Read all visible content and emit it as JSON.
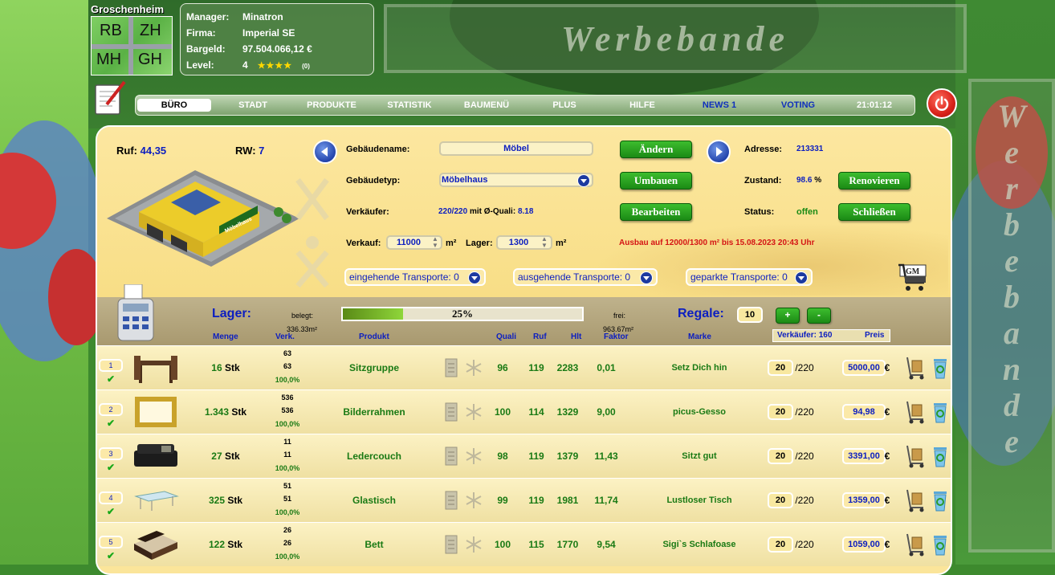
{
  "ad": {
    "top_text": "Werbebande",
    "right_letters": [
      "W",
      "e",
      "r",
      "b",
      "e",
      "b",
      "a",
      "n",
      "d",
      "e"
    ]
  },
  "city": {
    "name": "Groschenheim",
    "minimap_labels": [
      "RB",
      "ZH",
      "MH",
      "GH"
    ]
  },
  "manager_info": {
    "manager_label": "Manager:",
    "manager_value": "Minatron",
    "firma_label": "Firma:",
    "firma_value": "Imperial SE",
    "bargeld_label": "Bargeld:",
    "bargeld_value": "97.504.066,12 €",
    "level_label": "Level:",
    "level_value": "4",
    "level_stars": "★★★★",
    "level_count": "(0)"
  },
  "nav": {
    "items": [
      "BÜRO",
      "STADT",
      "PRODUKTE",
      "STATISTIK",
      "BAUMENÜ",
      "PLUS",
      "HILFE",
      "NEWS 1",
      "VOTING"
    ],
    "active": "BÜRO",
    "clock": "21:01:12"
  },
  "building": {
    "ruf_label": "Ruf:",
    "ruf_value": "44,35",
    "rw_label": "RW:",
    "rw_value": "7",
    "name_label": "Gebäudename:",
    "name_value": "Möbel",
    "type_label": "Gebäudetyp:",
    "type_value": "Möbelhaus",
    "verkaeufer_label": "Verkäufer:",
    "verkaeufer_value": "220/220",
    "quali_label": "mit Ø-Quali:",
    "quali_value": "8.18",
    "verkauf_label": "Verkauf:",
    "verkauf_value": "11000",
    "lager_label": "Lager:",
    "lager_value": "1300",
    "unit": "m²",
    "ausbau_notice": "Ausbau auf 12000/1300 m² bis 15.08.2023 20:43 Uhr",
    "adresse_label": "Adresse:",
    "adresse_value": "213331",
    "zustand_label": "Zustand:",
    "zustand_value": "98.6",
    "zustand_unit": "%",
    "status_label": "Status:",
    "status_value": "offen",
    "sign_text": "Möbelhaus"
  },
  "buttons": {
    "aendern": "Ändern",
    "umbauen": "Umbauen",
    "bearbeiten": "Bearbeiten",
    "renovieren": "Renovieren",
    "schliessen": "Schließen"
  },
  "transports": {
    "incoming": "eingehende Transporte: 0",
    "outgoing": "ausgehende Transporte: 0",
    "parked": "geparkte Transporte: 0"
  },
  "cart_label": "GM",
  "lager": {
    "title": "Lager:",
    "belegt_label": "belegt:",
    "belegt_value": "336.33m²",
    "progress": 0.25,
    "progress_text": "25%",
    "frei_label": "frei:",
    "frei_value": "963.67m²",
    "regale_label": "Regale:",
    "regale_value": "10",
    "plus": "+",
    "minus": "-"
  },
  "columns": {
    "menge": "Menge",
    "verk": "Verk.",
    "produkt": "Produkt",
    "quali": "Quali",
    "ruf": "Ruf",
    "hlt": "Hlt",
    "faktor": "Faktor",
    "marke": "Marke",
    "verkaeufer": "Verkäufer: 160",
    "preis": "Preis"
  },
  "rows": [
    {
      "num": "1",
      "menge": "16",
      "unit": "Stk",
      "verk1": "63",
      "verk2": "63",
      "verk_pct": "100,0%",
      "produkt": "Sitzgruppe",
      "quali": "96",
      "ruf": "119",
      "hlt": "2283",
      "faktor": "0,01",
      "marke": "Setz Dich hin",
      "verkaeufer": "20",
      "of": "/220",
      "preis": "5000,00",
      "currency": "€"
    },
    {
      "num": "2",
      "menge": "1.343",
      "unit": "Stk",
      "verk1": "536",
      "verk2": "536",
      "verk_pct": "100,0%",
      "produkt": "Bilderrahmen",
      "quali": "100",
      "ruf": "114",
      "hlt": "1329",
      "faktor": "9,00",
      "marke": "picus-Gesso",
      "verkaeufer": "20",
      "of": "/220",
      "preis": "94,98",
      "currency": "€"
    },
    {
      "num": "3",
      "menge": "27",
      "unit": "Stk",
      "verk1": "11",
      "verk2": "11",
      "verk_pct": "100,0%",
      "produkt": "Ledercouch",
      "quali": "98",
      "ruf": "119",
      "hlt": "1379",
      "faktor": "11,43",
      "marke": "Sitzt gut",
      "verkaeufer": "20",
      "of": "/220",
      "preis": "3391,00",
      "currency": "€"
    },
    {
      "num": "4",
      "menge": "325",
      "unit": "Stk",
      "verk1": "51",
      "verk2": "51",
      "verk_pct": "100,0%",
      "produkt": "Glastisch",
      "quali": "99",
      "ruf": "119",
      "hlt": "1981",
      "faktor": "11,74",
      "marke": "Lustloser Tisch",
      "verkaeufer": "20",
      "of": "/220",
      "preis": "1359,00",
      "currency": "€"
    },
    {
      "num": "5",
      "menge": "122",
      "unit": "Stk",
      "verk1": "26",
      "verk2": "26",
      "verk_pct": "100,0%",
      "produkt": "Bett",
      "quali": "100",
      "ruf": "115",
      "hlt": "1770",
      "faktor": "9,54",
      "marke": "Sigi`s Schlafoase",
      "verkaeufer": "20",
      "of": "/220",
      "preis": "1059,00",
      "currency": "€"
    }
  ]
}
